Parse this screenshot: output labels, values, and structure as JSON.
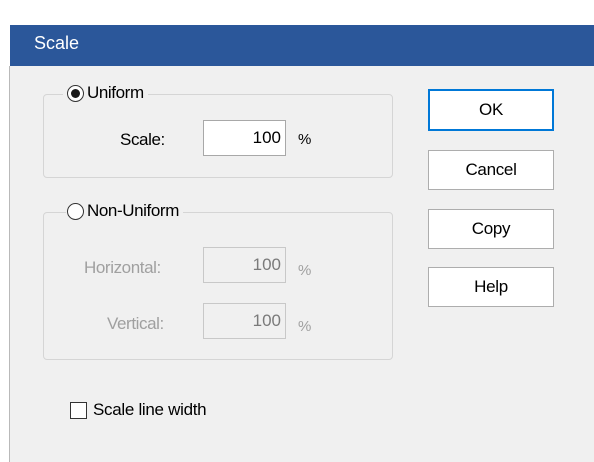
{
  "dialog": {
    "title": "Scale"
  },
  "uniform": {
    "option_label": "Uniform",
    "selected": true,
    "scale_label": "Scale:",
    "scale_value": "100",
    "unit": "%"
  },
  "non_uniform": {
    "option_label": "Non-Uniform",
    "selected": false,
    "horizontal_label": "Horizontal:",
    "horizontal_value": "100",
    "vertical_label": "Vertical:",
    "vertical_value": "100",
    "unit": "%"
  },
  "buttons": {
    "ok": "OK",
    "cancel": "Cancel",
    "copy": "Copy",
    "help": "Help"
  },
  "scale_line_width": {
    "label": "Scale line width",
    "checked": false
  },
  "colors": {
    "titlebar": "#2b579a",
    "default_button_border": "#0078d7"
  }
}
